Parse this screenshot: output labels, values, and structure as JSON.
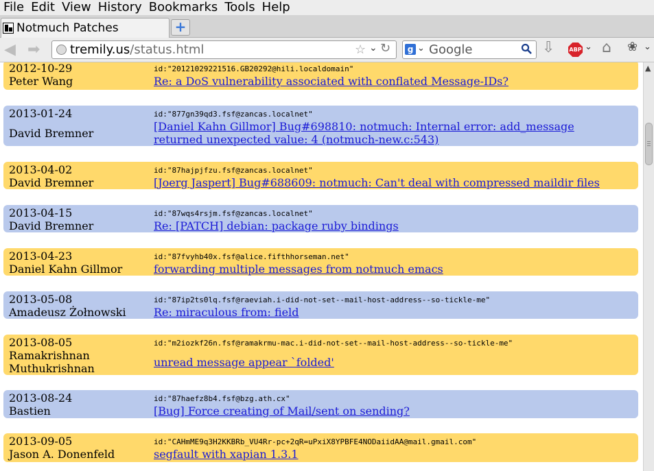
{
  "menubar": [
    "File",
    "Edit",
    "View",
    "History",
    "Bookmarks",
    "Tools",
    "Help"
  ],
  "tab": {
    "title": "Notmuch Patches",
    "newtab": "+"
  },
  "nav": {
    "url_host": "tremily.us",
    "url_path": "/status.html",
    "search_placeholder": "Google",
    "search_engine_icon": "g"
  },
  "icons": {
    "back": "back-arrow-icon",
    "forward": "forward-arrow-icon",
    "star": "bookmark-star-icon",
    "reload": "reload-icon",
    "download": "download-icon",
    "adblock": "adblock-plus-icon",
    "home": "home-icon"
  },
  "abp_label": "ABP",
  "entries": [
    {
      "date": "2012-10-29",
      "author": "Peter Wang",
      "id": "id:\"20121029221516.GB20292@hili.localdomain\"",
      "subject": "Re: a DoS vulnerability associated with conflated Message-IDs?",
      "color": "#ffd96b"
    },
    {
      "date": "2013-01-24",
      "author": "David Bremner",
      "id": "id:\"877gn39qd3.fsf@zancas.localnet\"",
      "subject": [
        "[Daniel Kahn Gillmor] Bug#698810: notmuch: Internal error: add_message",
        "returned unexpected value: 4 (notmuch-new.c:543)"
      ],
      "color": "#b9c9ec"
    },
    {
      "date": "2013-04-02",
      "author": "David Bremner",
      "id": "id:\"87hajpjfzu.fsf@zancas.localnet\"",
      "subject": "[Joerg Jaspert] Bug#688609: notmuch: Can't deal with compressed maildir files",
      "color": "#ffd96b"
    },
    {
      "date": "2013-04-15",
      "author": "David Bremner",
      "id": "id:\"87wqs4rsjm.fsf@zancas.localnet\"",
      "subject": "Re: [PATCH] debian: package ruby bindings",
      "color": "#b9c9ec"
    },
    {
      "date": "2013-04-23",
      "author": "Daniel Kahn Gillmor",
      "id": "id:\"87fvyhb40x.fsf@alice.fifthhorseman.net\"",
      "subject": "forwarding multiple messages from notmuch emacs",
      "color": "#ffd96b"
    },
    {
      "date": "2013-05-08",
      "author": "Amadeusz Żołnowski",
      "id": "id:\"87ip2ts0lq.fsf@raeviah.i-did-not-set--mail-host-address--so-tickle-me\"",
      "subject": "Re: miraculous from: field",
      "color": "#b9c9ec"
    },
    {
      "date": "2013-08-05",
      "author": [
        "Ramakrishnan",
        "Muthukrishnan"
      ],
      "id": "id:\"m2iozkf26n.fsf@ramakrmu-mac.i-did-not-set--mail-host-address--so-tickle-me\"",
      "subject": "unread message appear `folded'",
      "color": "#ffd96b"
    },
    {
      "date": "2013-08-24",
      "author": "Bastien",
      "id": "id:\"87haefz8b4.fsf@bzg.ath.cx\"",
      "subject": "[Bug] Force creating of Mail/sent on sending?",
      "color": "#b9c9ec"
    },
    {
      "date": "2013-09-05",
      "author": "Jason A. Donenfeld",
      "id": "id:\"CAHmME9q3H2KKBRb_VU4Rr-pc+2qR=uPxiX8YPBFE4NODaiidAA@mail.gmail.com\"",
      "subject": "segfault with xapian 1.3.1",
      "color": "#ffd96b"
    }
  ]
}
